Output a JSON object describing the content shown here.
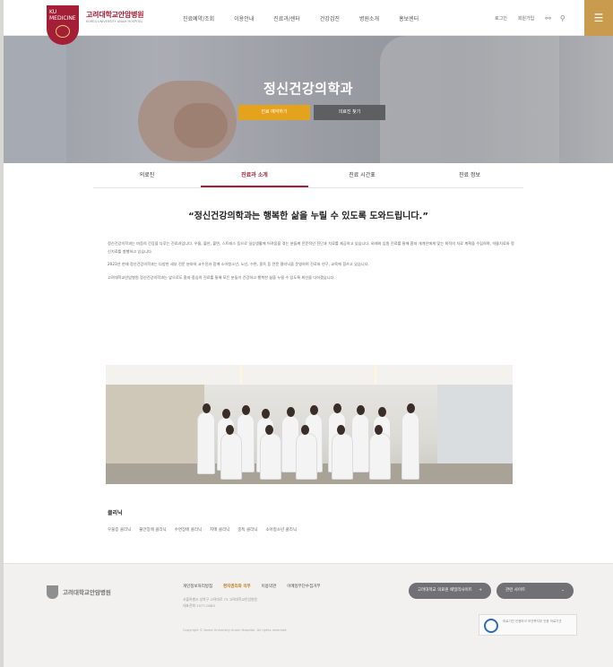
{
  "header": {
    "logo_badge": "KU MEDICINE",
    "logo_title": "고려대학교안암병원",
    "logo_subtitle": "KOREA UNIVERSITY ANAM HOSPITAL",
    "nav": [
      "진료예약/조회",
      "이용안내",
      "진료과/센터",
      "건강검진",
      "병원소개",
      "홍보센터"
    ],
    "utility": [
      "로그인",
      "회원가입"
    ],
    "icons": [
      "globe-icon",
      "search-icon",
      "menu-icon"
    ]
  },
  "hero": {
    "title": "정신건강의학과",
    "primary_button": "진료 예약하기",
    "secondary_button": "의료진 찾기"
  },
  "tabs": {
    "items": [
      "의료진",
      "진료과 소개",
      "진료 시간표",
      "진료 정보"
    ],
    "active_index": 1
  },
  "tagline": "“정신건강의학과는 행복한 삶을 누릴 수 있도록 도와드립니다.”",
  "intro": {
    "paragraphs": [
      "정신건강의학과는 마음의 건강을 다루는 진료과입니다. 우울, 불안, 불면, 스트레스 등으로 일상생활에 어려움을 겪는 분들께 전문적인 진단과 치료를 제공하고 있습니다. 외래와 입원 진료를 통해 환자 개개인에게 맞는 최적의 치료 계획을 수립하며, 약물치료와 정신치료를 병행하고 있습니다.",
      "2023년 현재 정신건강의학과는 다양한 세부 전문 분야의 교수진과 함께 소아청소년, 노인, 수면, 중독 등 전문 클리닉을 운영하며 진료와 연구, 교육에 힘쓰고 있습니다.",
      "고려대학교안암병원 정신건강의학과는 앞으로도 환자 중심의 진료를 통해 모든 분들이 건강하고 행복한 삶을 누릴 수 있도록 최선을 다하겠습니다."
    ]
  },
  "clinics": {
    "title": "클리닉",
    "items": [
      "우울증 클리닉",
      "불안장애 클리닉",
      "수면장애 클리닉",
      "치매 클리닉",
      "중독 클리닉",
      "소아청소년 클리닉"
    ]
  },
  "footer": {
    "logo_text": "고려대학교안암병원",
    "links": [
      "개인정보처리방침",
      "환자권리와 의무",
      "이용약관",
      "이메일무단수집거부"
    ],
    "highlight_index": 1,
    "info": [
      "서울특별시 성북구 고려대로 73 고려대학교안암병원",
      "대표전화 1577-0083"
    ],
    "copyright": "Copyright © Korea University Anam Hospital. All rights reserved.",
    "family_site_button": "고려대학교 의료원 패밀리사이트",
    "select_button": "관련 사이트",
    "cert_text": "의료기관 인증마크 보건복지부 인증 의료기관"
  },
  "colors": {
    "brand": "#a41f35",
    "accent_gold": "#c99b4f",
    "hero_primary": "#e5a21c",
    "hero_secondary": "#5e5f63"
  }
}
